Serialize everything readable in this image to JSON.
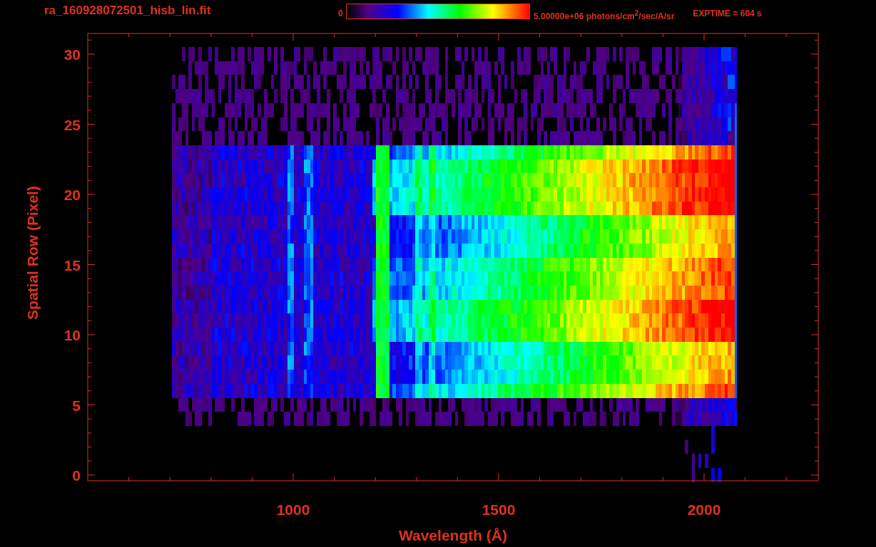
{
  "title": "ra_160928072501_hisb_lin.fit",
  "colorbar": {
    "min_label": "0",
    "max_label": "5.00000e+06 photons/cm$^{2}$/sec/A/sr"
  },
  "exposure": "EXPTIME = 604 s",
  "plot": {
    "ylabel": "Spatial Row (Pixel)",
    "xlabel": "Wavelength (Å)",
    "yticks": [
      "30",
      "25",
      "20",
      "15",
      "10",
      "5",
      "0"
    ],
    "xticks": [
      "1000",
      "1500",
      "2000"
    ]
  }
}
